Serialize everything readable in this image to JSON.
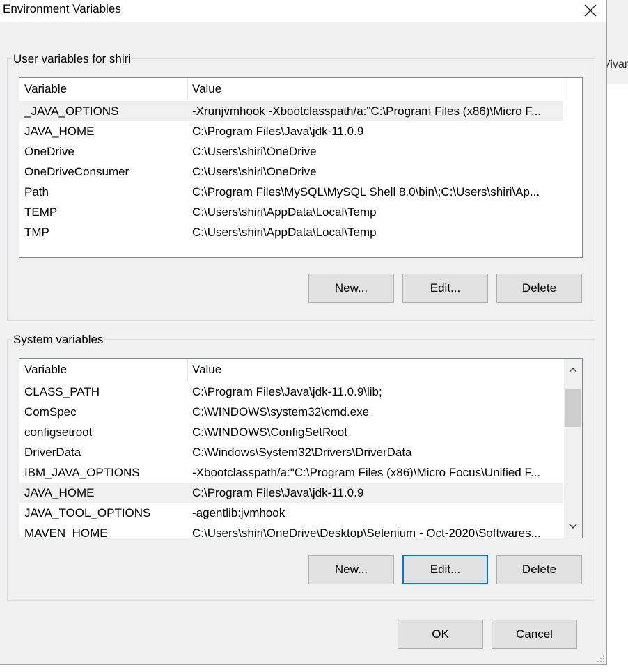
{
  "window": {
    "title": "Environment Variables",
    "close_icon": "close-icon"
  },
  "background": {
    "partial_text": "Vivar"
  },
  "user_section": {
    "title": "User variables for shiri",
    "columns": [
      "Variable",
      "Value"
    ],
    "rows": [
      {
        "variable": "_JAVA_OPTIONS",
        "value": "-Xrunjvmhook -Xbootclasspath/a:\"C:\\Program Files (x86)\\Micro F..."
      },
      {
        "variable": "JAVA_HOME",
        "value": "C:\\Program Files\\Java\\jdk-11.0.9"
      },
      {
        "variable": "OneDrive",
        "value": "C:\\Users\\shiri\\OneDrive"
      },
      {
        "variable": "OneDriveConsumer",
        "value": "C:\\Users\\shiri\\OneDrive"
      },
      {
        "variable": "Path",
        "value": "C:\\Program Files\\MySQL\\MySQL Shell 8.0\\bin\\;C:\\Users\\shiri\\Ap..."
      },
      {
        "variable": "TEMP",
        "value": "C:\\Users\\shiri\\AppData\\Local\\Temp"
      },
      {
        "variable": "TMP",
        "value": "C:\\Users\\shiri\\AppData\\Local\\Temp"
      }
    ],
    "selected_index": 0,
    "buttons": {
      "new": "New...",
      "edit": "Edit...",
      "delete": "Delete"
    }
  },
  "system_section": {
    "title": "System variables",
    "columns": [
      "Variable",
      "Value"
    ],
    "rows": [
      {
        "variable": "CLASS_PATH",
        "value": "C:\\Program Files\\Java\\jdk-11.0.9\\lib;"
      },
      {
        "variable": "ComSpec",
        "value": "C:\\WINDOWS\\system32\\cmd.exe"
      },
      {
        "variable": "configsetroot",
        "value": "C:\\WINDOWS\\ConfigSetRoot"
      },
      {
        "variable": "DriverData",
        "value": "C:\\Windows\\System32\\Drivers\\DriverData"
      },
      {
        "variable": "IBM_JAVA_OPTIONS",
        "value": "-Xbootclasspath/a:\"C:\\Program Files (x86)\\Micro Focus\\Unified F..."
      },
      {
        "variable": "JAVA_HOME",
        "value": "C:\\Program Files\\Java\\jdk-11.0.9"
      },
      {
        "variable": "JAVA_TOOL_OPTIONS",
        "value": "-agentlib:jvmhook"
      },
      {
        "variable": "MAVEN_HOME",
        "value": "C:\\Users\\shiri\\OneDrive\\Desktop\\Selenium - Oct-2020\\Softwares..."
      }
    ],
    "selected_index": 5,
    "buttons": {
      "new": "New...",
      "edit": "Edit...",
      "delete": "Delete"
    }
  },
  "footer": {
    "ok": "OK",
    "cancel": "Cancel"
  },
  "colors": {
    "dialog_bg": "#f0f0f0",
    "list_bg": "#ffffff",
    "button_bg": "#e1e1e1",
    "focus_border": "#0078d7",
    "selected_row": "#f0f0f0"
  }
}
